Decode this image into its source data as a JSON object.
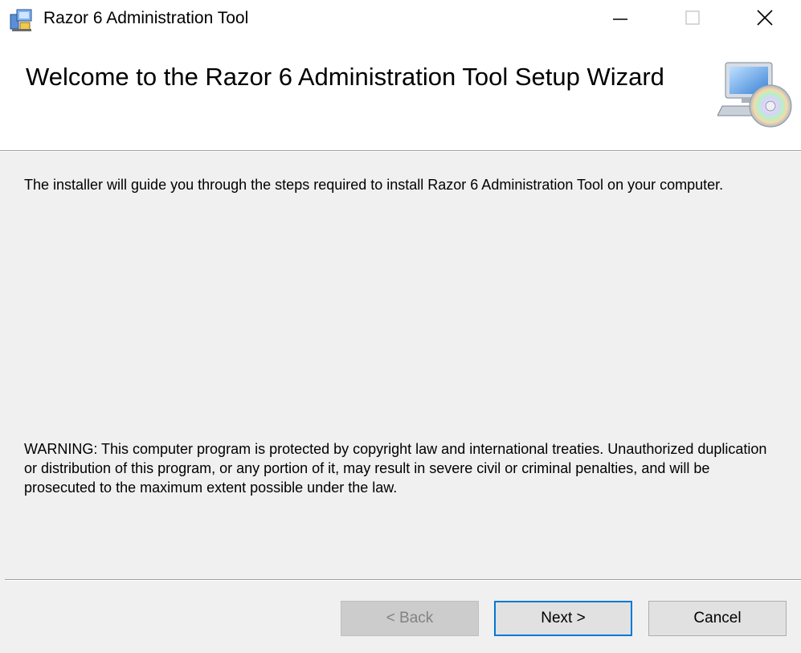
{
  "window": {
    "title": "Razor 6 Administration Tool",
    "app_icon": "installer-icon",
    "controls": {
      "minimize_icon": "minimize-icon",
      "maximize_icon": "maximize-icon",
      "close_icon": "close-icon"
    }
  },
  "header": {
    "title": "Welcome to the Razor 6 Administration Tool Setup Wizard",
    "icon": "computer-cd-icon"
  },
  "body": {
    "intro": "The installer will guide you through the steps required to install Razor 6 Administration Tool on your computer.",
    "warning": "WARNING: This computer program is protected by copyright law and international treaties. Unauthorized duplication or distribution of this program, or any portion of it, may result in severe civil or criminal penalties, and will be prosecuted to the maximum extent possible under the law."
  },
  "buttons": {
    "back": "< Back",
    "next": "Next >",
    "cancel": "Cancel"
  },
  "colors": {
    "focus_accent": "#0078d7",
    "window_bg": "#f0f0f0"
  }
}
